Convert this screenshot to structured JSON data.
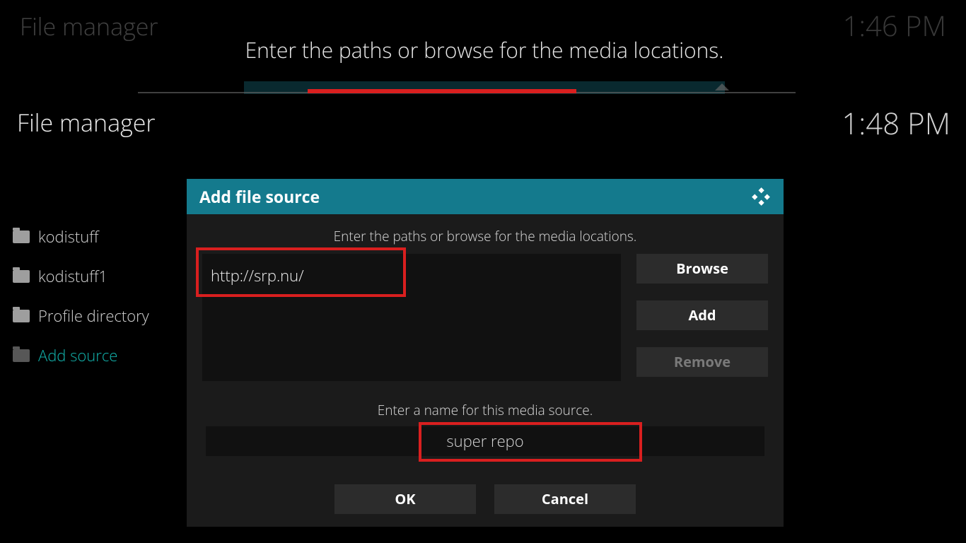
{
  "background": {
    "header": "File manager",
    "clock": "1:46 PM",
    "banner": "Enter the paths or browse for the media locations."
  },
  "header": {
    "title": "File manager",
    "clock": "1:48 PM"
  },
  "sidebar": {
    "items": [
      {
        "label": "kodistuff"
      },
      {
        "label": "kodistuff1"
      },
      {
        "label": "Profile directory"
      },
      {
        "label": "Add source"
      }
    ]
  },
  "dialog": {
    "title": "Add file source",
    "instruction1": "Enter the paths or browse for the media locations.",
    "path_value": "http://srp.nu/",
    "buttons": {
      "browse": "Browse",
      "add": "Add",
      "remove": "Remove",
      "ok": "OK",
      "cancel": "Cancel"
    },
    "instruction2": "Enter a name for this media source.",
    "name_value": "super repo"
  }
}
